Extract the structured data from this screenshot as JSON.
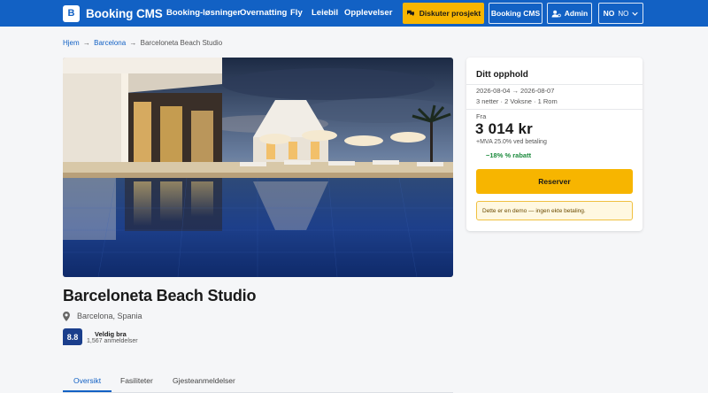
{
  "header": {
    "logo_letter": "B",
    "brand": "Booking CMS",
    "nav": [
      "Booking-løsninger",
      "Overnatting",
      "Fly",
      "Leiebil",
      "Opplevelser"
    ],
    "discuss_button": "Diskuter prosjekt",
    "cms_button": "Booking CMS",
    "admin_button": "Admin",
    "lang_code": "NO",
    "lang_label": "NO"
  },
  "breadcrumb": {
    "home": "Hjem",
    "city": "Barcelona",
    "current": "Barceloneta Beach Studio",
    "separator": "→"
  },
  "property": {
    "title": "Barceloneta Beach Studio",
    "location": "Barcelona, Spania",
    "score": "8.8",
    "score_label": "Veldig bra",
    "review_count": "1,567 anmeldelser"
  },
  "tabs": [
    "Oversikt",
    "Fasiliteter",
    "Gjesteanmeldelser"
  ],
  "booking": {
    "title": "Ditt opphold",
    "dates": "2026-08-04 → 2026-08-07",
    "details": "3 netter · 2 Voksne · 1 Rom",
    "from_label": "Fra",
    "price": "3 014 kr",
    "vat": "+MVA 25.0% ved betaling",
    "discount": "−18% % rabatt",
    "reserve_button": "Reserver",
    "demo_note": "Dette er en demo — ingen ekte betaling."
  },
  "colors": {
    "brand_blue": "#1261c4",
    "accent_yellow": "#f7b500",
    "score_navy": "#1a3e8c",
    "discount_green": "#1b8a3c"
  }
}
